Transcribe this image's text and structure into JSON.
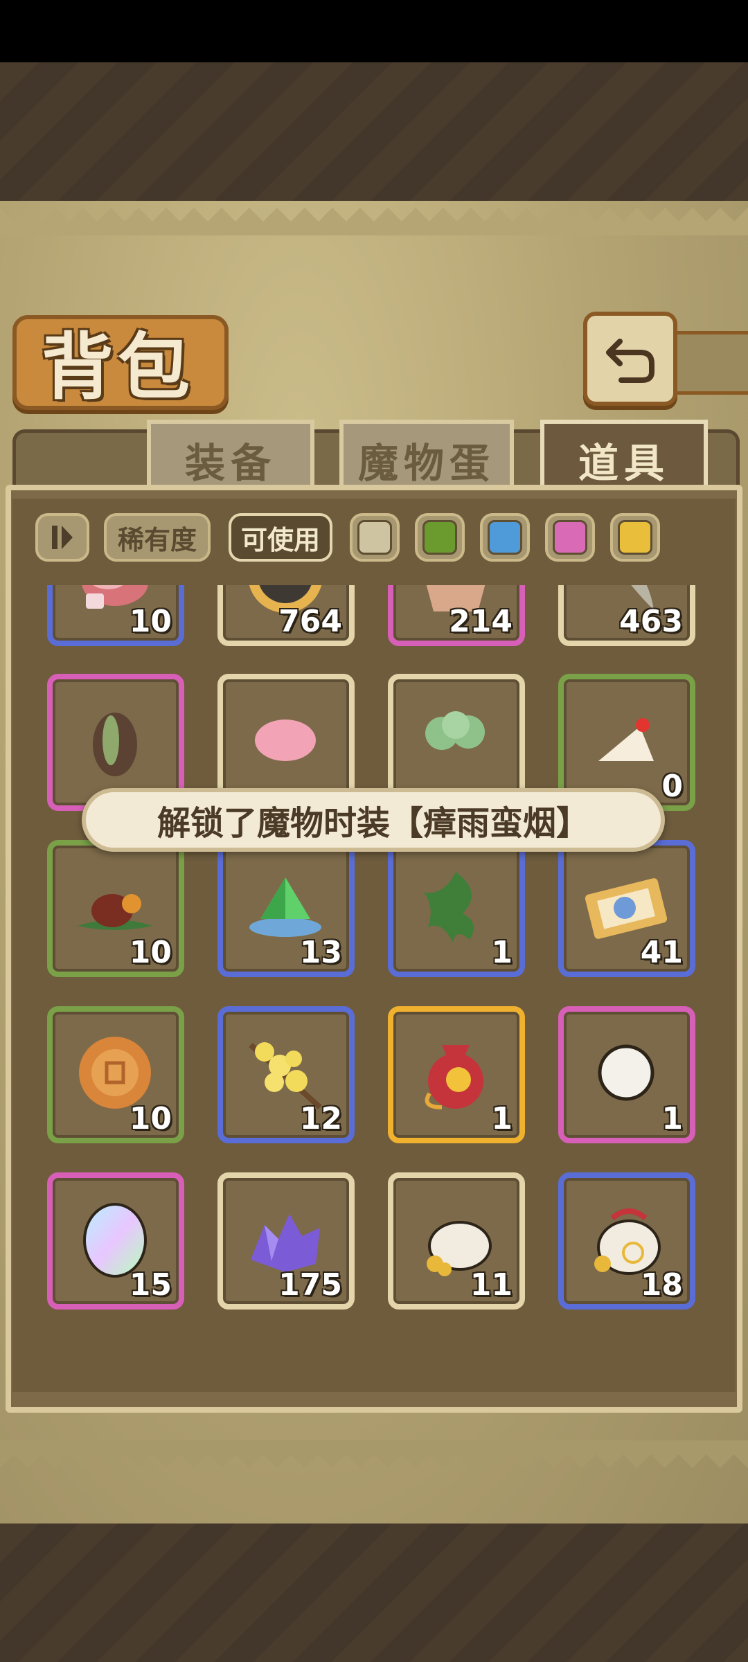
{
  "header": {
    "title": "背包"
  },
  "tabs": [
    {
      "label": "装备",
      "active": false
    },
    {
      "label": "魔物蛋",
      "active": false
    },
    {
      "label": "道具",
      "active": true
    }
  ],
  "filters": {
    "rarity_label": "稀有度",
    "usable_label": "可使用",
    "colors": [
      "#cfc4a2",
      "#6b9a2e",
      "#4f9ad8",
      "#d86ab6",
      "#e8be3a"
    ]
  },
  "toast": {
    "text": "解锁了魔物时装【瘴雨蛮烟】"
  },
  "items": [
    {
      "name": "marbled-meat-icon",
      "count": "10",
      "rarity": "blue"
    },
    {
      "name": "pie-icon",
      "count": "764",
      "rarity": "white"
    },
    {
      "name": "bread-basket-icon",
      "count": "214",
      "rarity": "pink"
    },
    {
      "name": "fish-icon",
      "count": "463",
      "rarity": "white"
    },
    {
      "name": "seed-icon",
      "count": "",
      "rarity": "pink"
    },
    {
      "name": "pink-meat-icon",
      "count": "",
      "rarity": "white"
    },
    {
      "name": "radish-icon",
      "count": "",
      "rarity": "white"
    },
    {
      "name": "cake-slice-icon",
      "count": "0",
      "rarity": "green"
    },
    {
      "name": "braised-meat-icon",
      "count": "10",
      "rarity": "green"
    },
    {
      "name": "green-gem-icon",
      "count": "13",
      "rarity": "blue"
    },
    {
      "name": "herb-leaf-icon",
      "count": "1",
      "rarity": "blue"
    },
    {
      "name": "snail-ticket-icon",
      "count": "41",
      "rarity": "blue"
    },
    {
      "name": "mooncake-icon",
      "count": "10",
      "rarity": "green"
    },
    {
      "name": "osmanthus-icon",
      "count": "12",
      "rarity": "blue"
    },
    {
      "name": "lucky-bag-icon",
      "count": "1",
      "rarity": "gold"
    },
    {
      "name": "white-ball-icon",
      "count": "1",
      "rarity": "pink"
    },
    {
      "name": "rainbow-egg-icon",
      "count": "15",
      "rarity": "pink"
    },
    {
      "name": "purple-crystal-icon",
      "count": "175",
      "rarity": "white"
    },
    {
      "name": "coin-sack-icon",
      "count": "11",
      "rarity": "white"
    },
    {
      "name": "coin-bag-icon",
      "count": "18",
      "rarity": "blue"
    }
  ]
}
